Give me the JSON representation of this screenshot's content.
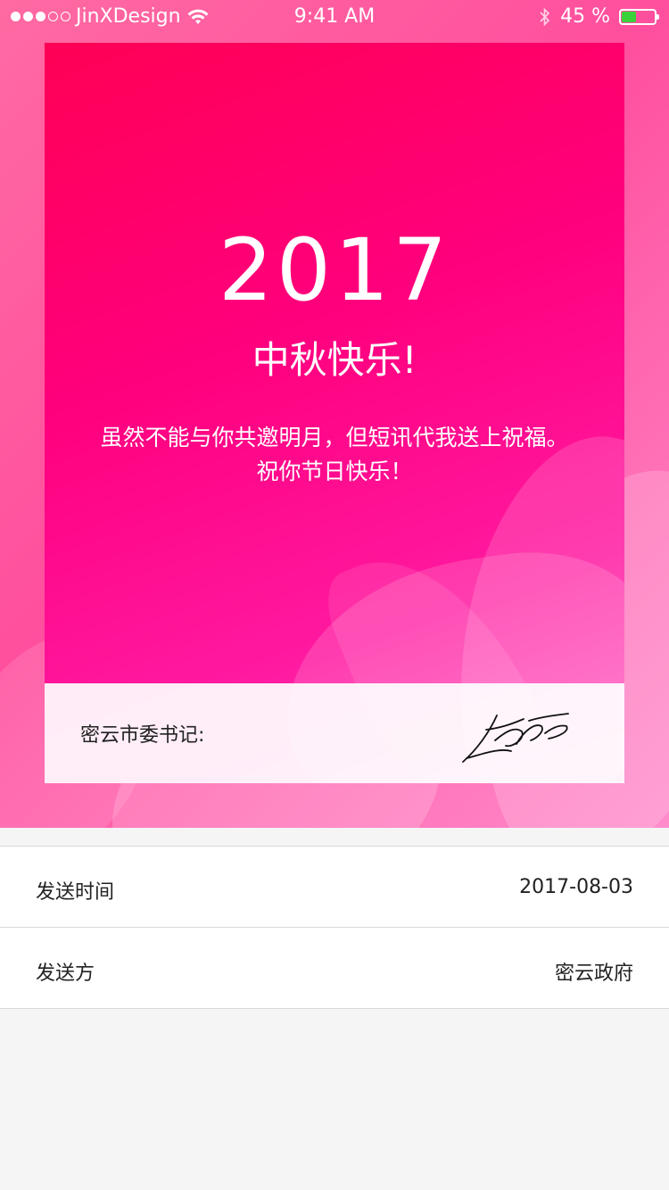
{
  "status_bar": {
    "carrier": "JinXDesign",
    "time": "9:41 AM",
    "battery_text": "45 %",
    "battery_level": 0.45,
    "signal_bars_filled": 3,
    "signal_bars_total": 5,
    "battery_color": "#3ad13a"
  },
  "card": {
    "year": "2017",
    "title": "中秋快乐!",
    "message_line1": "虽然不能与你共邀明月，但短讯代我送上祝福。",
    "message_line2": "祝你节日快乐！",
    "signer_label": "密云市委书记:",
    "signature_icon": "handwritten-signature"
  },
  "details": [
    {
      "label": "发送时间",
      "value": "2017-08-03"
    },
    {
      "label": "发送方",
      "value": "密云政府"
    }
  ],
  "colors": {
    "card_gradient_start": "#ff0055",
    "card_gradient_end": "#ff55c0",
    "hero_background": "#ff6aa2"
  }
}
